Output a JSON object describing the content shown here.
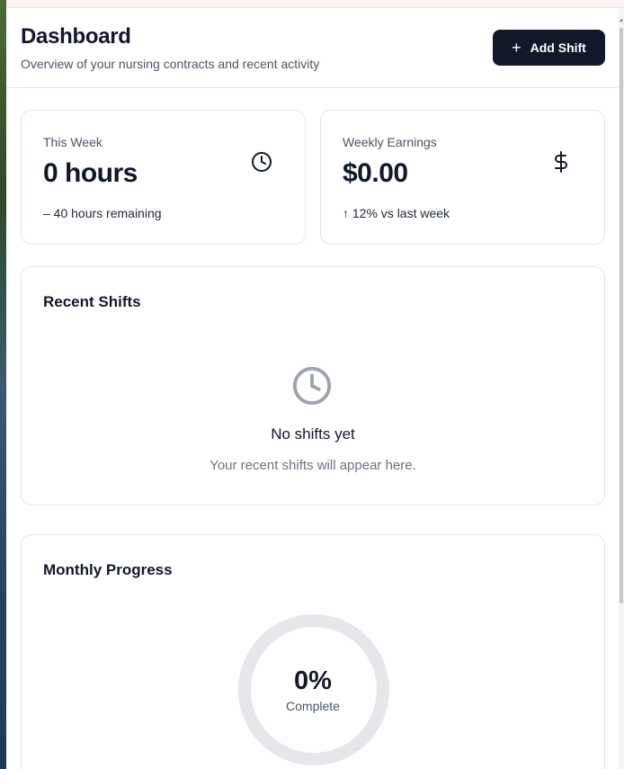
{
  "header": {
    "title": "Dashboard",
    "subtitle": "Overview of your nursing contracts and recent activity",
    "add_button_label": "Add Shift",
    "add_button_icon": "plus-icon"
  },
  "stats": [
    {
      "label": "This Week",
      "value": "0 hours",
      "note": "– 40 hours remaining",
      "icon": "clock-icon"
    },
    {
      "label": "Weekly Earnings",
      "value": "$0.00",
      "note": "↑ 12% vs last week",
      "icon": "dollar-icon"
    }
  ],
  "recent_shifts": {
    "title": "Recent Shifts",
    "empty_icon": "clock-icon",
    "empty_title": "No shifts yet",
    "empty_subtitle": "Your recent shifts will appear here."
  },
  "monthly_progress": {
    "title": "Monthly Progress",
    "percent": 0,
    "value_label": "0%",
    "caption": "Complete"
  },
  "colors": {
    "primary": "#111827",
    "border": "#e5e7eb",
    "muted_text": "#6b7280",
    "ring_track": "#e5e7eb",
    "ring_fill": "#111827",
    "empty_icon": "#9ca3af"
  }
}
